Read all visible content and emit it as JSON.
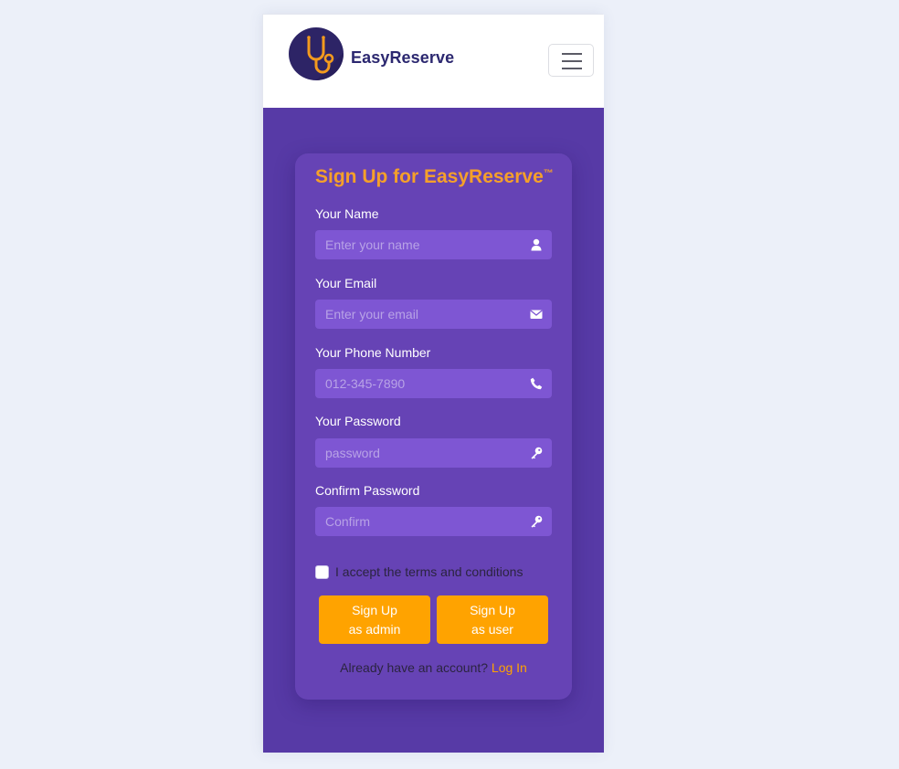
{
  "brand": {
    "name": "EasyReserve",
    "logo_icon": "stethoscope-icon"
  },
  "nav": {
    "toggle_icon": "hamburger-menu-icon"
  },
  "signup": {
    "title": "Sign Up for EasyReserve",
    "trademark": "™",
    "fields": [
      {
        "label": "Your Name",
        "placeholder": "Enter your name",
        "value": "",
        "icon": "user-icon"
      },
      {
        "label": "Your Email",
        "placeholder": "Enter your email",
        "value": "",
        "icon": "envelope-icon"
      },
      {
        "label": "Your Phone Number",
        "placeholder": "012-345-7890",
        "value": "",
        "icon": "phone-icon"
      },
      {
        "label": "Your Password",
        "placeholder": "password",
        "value": "",
        "icon": "key-icon"
      },
      {
        "label": "Confirm Password",
        "placeholder": "Confirm",
        "value": "",
        "icon": "key-icon"
      }
    ],
    "terms_label": "I accept the terms and conditions",
    "terms_checked": false,
    "buttons": {
      "admin_line1": "Sign Up",
      "admin_line2": "as admin",
      "user_line1": "Sign Up",
      "user_line2": "as user"
    },
    "login_prompt": "Already have an account?",
    "login_link": "Log In"
  },
  "colors": {
    "page_bg": "#ecf0f9",
    "hero_bg": "#573aa6",
    "card_bg": "#6643b5",
    "input_bg": "#7e56d3",
    "accent_orange": "#ffa300",
    "title_orange": "#f5a02a",
    "brand_navy": "#2c2870"
  }
}
